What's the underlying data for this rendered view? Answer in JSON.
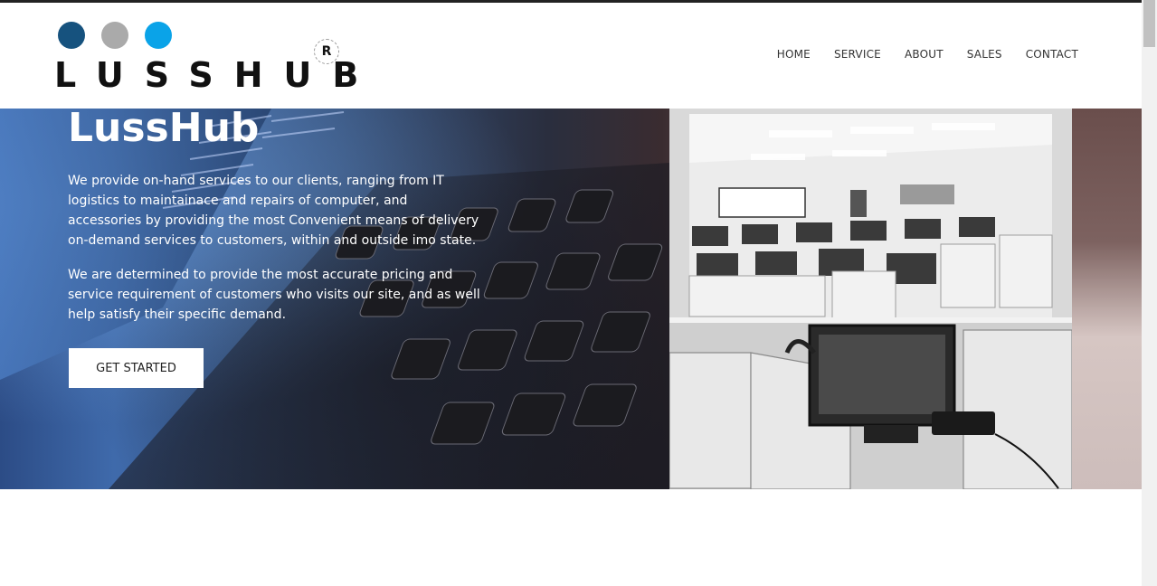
{
  "brand": {
    "name": "LUSSHUB",
    "registered_mark": "R",
    "dot_colors": [
      "#16527e",
      "#aaaaaa",
      "#0aa3e8"
    ]
  },
  "nav": {
    "items": [
      {
        "label": "HOME"
      },
      {
        "label": "SERVICE"
      },
      {
        "label": "ABOUT"
      },
      {
        "label": "SALES"
      },
      {
        "label": "CONTACT"
      }
    ]
  },
  "hero": {
    "title": "LussHub",
    "paragraph_1": "We provide on-hand services to our clients, ranging from IT logistics to maintainace and repairs of computer, and accessories by providing the most Convenient means of delivery on-demand services to customers, within and outside imo state.",
    "paragraph_2": "We are determined to provide the most accurate pricing and service requirement of customers who visits our site, and as well help satisfy their specific demand.",
    "cta_label": "GET STARTED"
  },
  "colors": {
    "accent_dark_blue": "#16527e",
    "accent_light_blue": "#0aa3e8",
    "text_dark": "#222222"
  }
}
